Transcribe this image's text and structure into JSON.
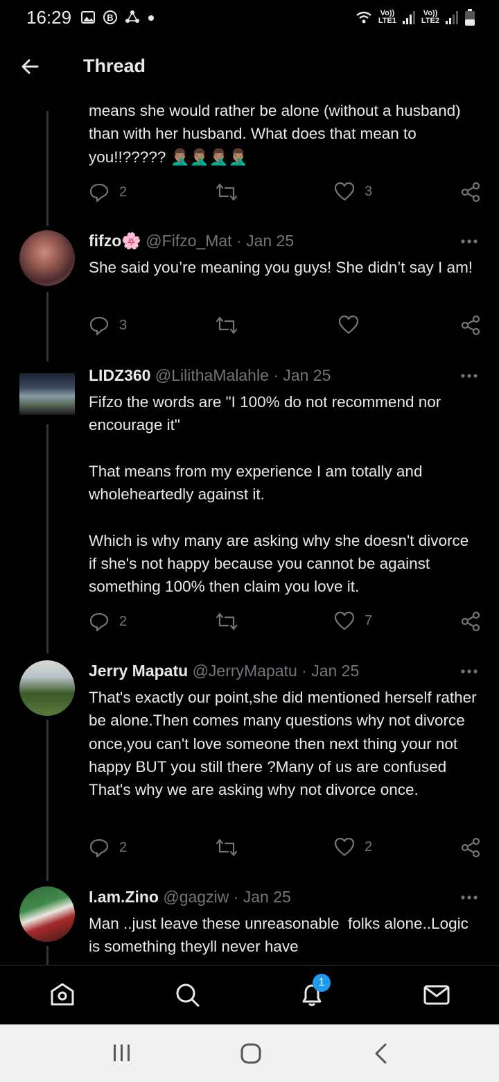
{
  "status_bar": {
    "time": "16:29",
    "left_icons": [
      "image-icon",
      "b-icon",
      "sync-icon",
      "dot-icon"
    ],
    "network": [
      {
        "top": "Vo))",
        "bottom": "LTE1"
      },
      {
        "top": "Vo))",
        "bottom": "LTE2"
      }
    ]
  },
  "header": {
    "title": "Thread",
    "back_icon": "arrow-left-icon"
  },
  "partial_tweet": {
    "text": "means she would rather be alone (without a husband)  than with her husband. What does that mean to you!!????? 🤦🏽‍♂️🤦🏽‍♂️🤦🏽‍♂️🤦🏽‍♂️",
    "replies": "2",
    "retweets": "",
    "likes": "3"
  },
  "tweets": [
    {
      "name": "fifzo🌸",
      "handle": "@Fifzo_Mat",
      "date": "Jan 25",
      "separator": "·",
      "text": "She said you’re meaning you guys! She didn’t say I am!",
      "replies": "3",
      "retweets": "",
      "likes": ""
    },
    {
      "name": "LIDZ360",
      "handle": "@LilithaMalahle",
      "date": "Jan 25",
      "separator": "·",
      "text": "Fifzo the words are \"I 100% do not recommend nor encourage it\"\n\nThat means from my experience I am totally and wholeheartedly against it.\n\nWhich is why many are asking why she doesn't divorce if she's not happy because you cannot be against something 100% then claim you love it.",
      "replies": "2",
      "retweets": "",
      "likes": "7"
    },
    {
      "name": "Jerry Mapatu",
      "handle": "@JerryMapatu",
      "date": "Jan 25",
      "separator": "·",
      "text": "That's exactly our point,she did mentioned herself rather be alone.Then comes many questions why not divorce once,you can't love someone then next thing your not happy BUT you still there ?Many of us are confused That's why we are asking why not divorce once.",
      "replies": "2",
      "retweets": "",
      "likes": "2"
    },
    {
      "name": "I.am.Zino",
      "handle": "@gagziw",
      "date": "Jan 25",
      "separator": "·",
      "text": "Man ..just leave these unreasonable  folks alone..Logic is something theyll never have",
      "replies": "",
      "retweets": "",
      "likes": ""
    }
  ],
  "bottom_nav": {
    "items": [
      "home-icon",
      "search-icon",
      "notifications-icon",
      "messages-icon"
    ],
    "notification_count": "1"
  },
  "system_nav": [
    "recents-icon",
    "home-circle-icon",
    "back-chevron-icon"
  ],
  "colors": {
    "background": "#000000",
    "text": "#e7e9ea",
    "secondary": "#71767b",
    "accent": "#1d9bf0"
  }
}
